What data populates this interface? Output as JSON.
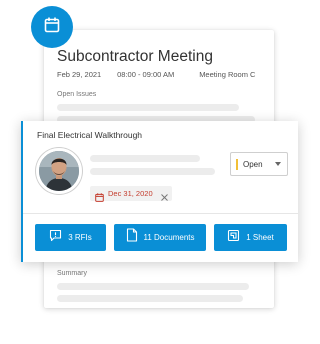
{
  "meeting": {
    "title": "Subcontractor Meeting",
    "date": "Feb 29, 2021",
    "time": "08:00 - 09:00 AM",
    "location": "Meeting Room C",
    "open_issues_label": "Open Issues",
    "summary_label": "Summary"
  },
  "task": {
    "title": "Final Electrical Walkthrough",
    "status": "Open",
    "due_date": "Dec 31, 2020"
  },
  "actions": {
    "rfis": "3 RFIs",
    "documents": "11 Documents",
    "sheet": "1 Sheet"
  },
  "colors": {
    "accent": "#0a8fd6",
    "overdue": "#c43d2e",
    "status_open": "#f2c037"
  },
  "icons": {
    "badge": "calendar-icon",
    "rfis": "speech-bubble-icon",
    "documents": "document-icon",
    "sheet": "sheet-icon"
  }
}
